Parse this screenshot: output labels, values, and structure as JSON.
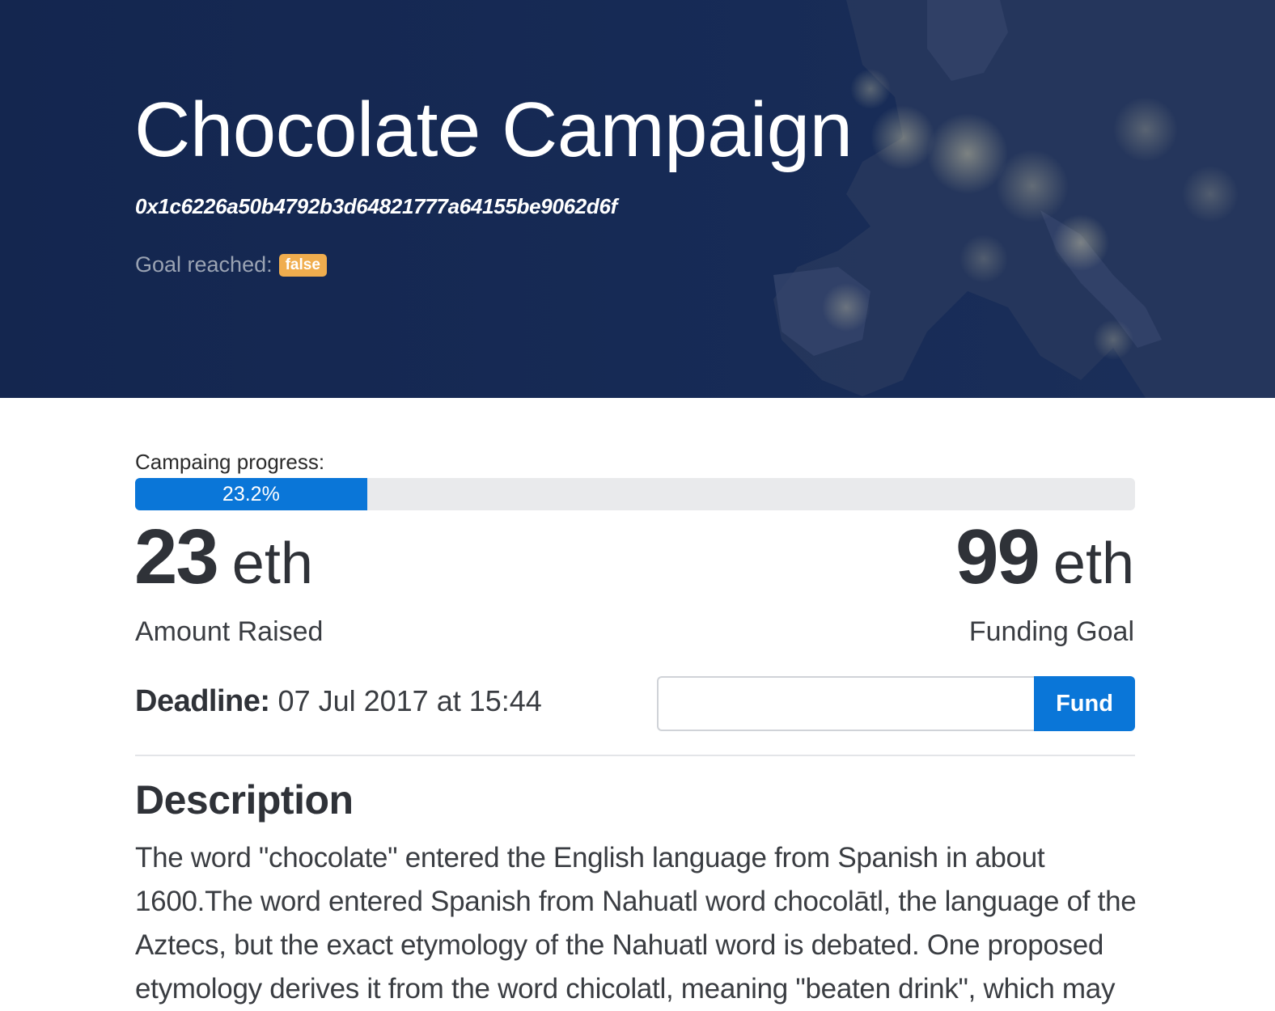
{
  "campaign": {
    "title": "Chocolate Campaign",
    "address": "0x1c6226a50b4792b3d64821777a64155be9062d6f",
    "goal_reached_label": "Goal reached:",
    "goal_reached_value": "false"
  },
  "progress": {
    "label": "Campaing progress:",
    "percent_text": "23.2%",
    "fraction": 0.232
  },
  "stats": {
    "raised_value": "23",
    "raised_unit": "eth",
    "raised_caption": "Amount Raised",
    "goal_value": "99",
    "goal_unit": "eth",
    "goal_caption": "Funding Goal"
  },
  "deadline": {
    "label": "Deadline:",
    "value": "07 Jul 2017 at 15:44"
  },
  "fund": {
    "input_value": "",
    "button_label": "Fund"
  },
  "description": {
    "heading": "Description",
    "text": "The word \"chocolate\" entered the English language from Spanish in about 1600.The word entered Spanish from Nahuatl word chocolātl, the language of the Aztecs, but the exact etymology of the Nahuatl word is debated. One proposed etymology derives it from the word chicolatl, meaning \"beaten drink\", which may"
  },
  "colors": {
    "hero_bg": "#162a55",
    "accent": "#0a76d8",
    "badge_warning": "#f0ad4e"
  }
}
